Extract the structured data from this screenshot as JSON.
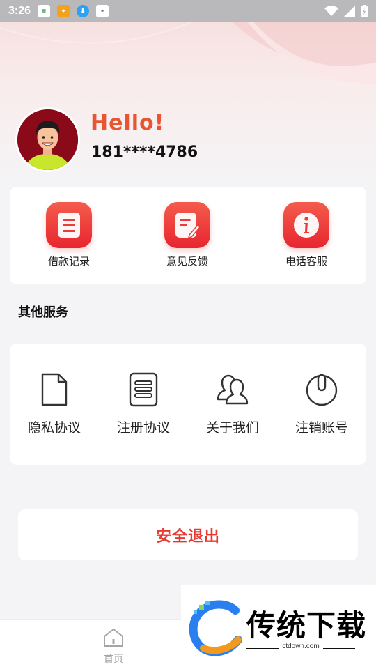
{
  "status_bar": {
    "time": "3:26",
    "notification_icons": [
      "app-notification-icon",
      "app-notification-icon",
      "download-icon",
      "app-notification-icon"
    ],
    "right_icons": [
      "wifi-icon",
      "signal-icon",
      "battery-icon"
    ]
  },
  "profile": {
    "greeting": "Hello!",
    "phone": "181****4786"
  },
  "quick_actions": [
    {
      "label": "借款记录",
      "icon": "document-list-icon"
    },
    {
      "label": "意见反馈",
      "icon": "feedback-edit-icon"
    },
    {
      "label": "电话客服",
      "icon": "info-icon"
    }
  ],
  "section_title": "其他服务",
  "services": [
    {
      "label": "隐私协议",
      "icon": "file-icon"
    },
    {
      "label": "注册协议",
      "icon": "notepad-icon"
    },
    {
      "label": "关于我们",
      "icon": "users-icon"
    },
    {
      "label": "注销账号",
      "icon": "power-icon"
    }
  ],
  "logout_label": "安全退出",
  "tabbar": {
    "home_label": "首页"
  },
  "watermark": {
    "brand": "传统下载",
    "url": "ctdown.com"
  },
  "colors": {
    "accent": "#e43a31",
    "hello": "#e95530",
    "icon_gradient_top": "#f45c4c",
    "icon_gradient_bottom": "#e7252f"
  }
}
